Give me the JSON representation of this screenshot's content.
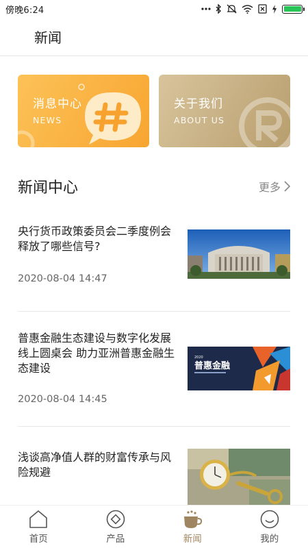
{
  "status_bar": {
    "time": "傍晚6:24",
    "battery_level": 1.0,
    "icons": [
      "dots-icon",
      "bluetooth-icon",
      "mute-icon",
      "wifi-icon",
      "sim-x-icon",
      "charging-icon",
      "battery-icon"
    ]
  },
  "header": {
    "title": "新闻"
  },
  "banners": [
    {
      "title": "消息中心",
      "subtitle": "NEWS",
      "color_from": "#fcc257",
      "color_to": "#f8a531",
      "icon": "hash-bubble-icon"
    },
    {
      "title": "关于我们",
      "subtitle": "ABOUT US",
      "color_from": "#d8c49c",
      "color_to": "#b89e6e",
      "icon": "brand-r-logo-icon"
    }
  ],
  "section": {
    "title": "新闻中心",
    "more_label": "更多"
  },
  "news": [
    {
      "title": "央行货币政策委员会二季度例会释放了哪些信号?",
      "date": "2020-08-04 14:47",
      "image": "bank-building-photo"
    },
    {
      "title": "普惠金融生态建设与数字化发展线上圆桌会 助力亚洲普惠金融生态建设",
      "date": "2020-08-04 14:45",
      "image": "inclusive-finance-poster",
      "image_caption": "普惠金融"
    },
    {
      "title": "浅谈高净值人群的财富传承与风险规避",
      "date": "",
      "image": "watch-keys-cash-photo"
    }
  ],
  "bottom_nav": [
    {
      "label": "首页",
      "icon": "home-icon",
      "active": false
    },
    {
      "label": "产品",
      "icon": "product-icon",
      "active": false
    },
    {
      "label": "新闻",
      "icon": "news-cup-icon",
      "active": true
    },
    {
      "label": "我的",
      "icon": "profile-icon",
      "active": false
    }
  ],
  "colors": {
    "accent": "#a08660",
    "news_banner": "#f8a531",
    "about_banner": "#b89e6e"
  }
}
